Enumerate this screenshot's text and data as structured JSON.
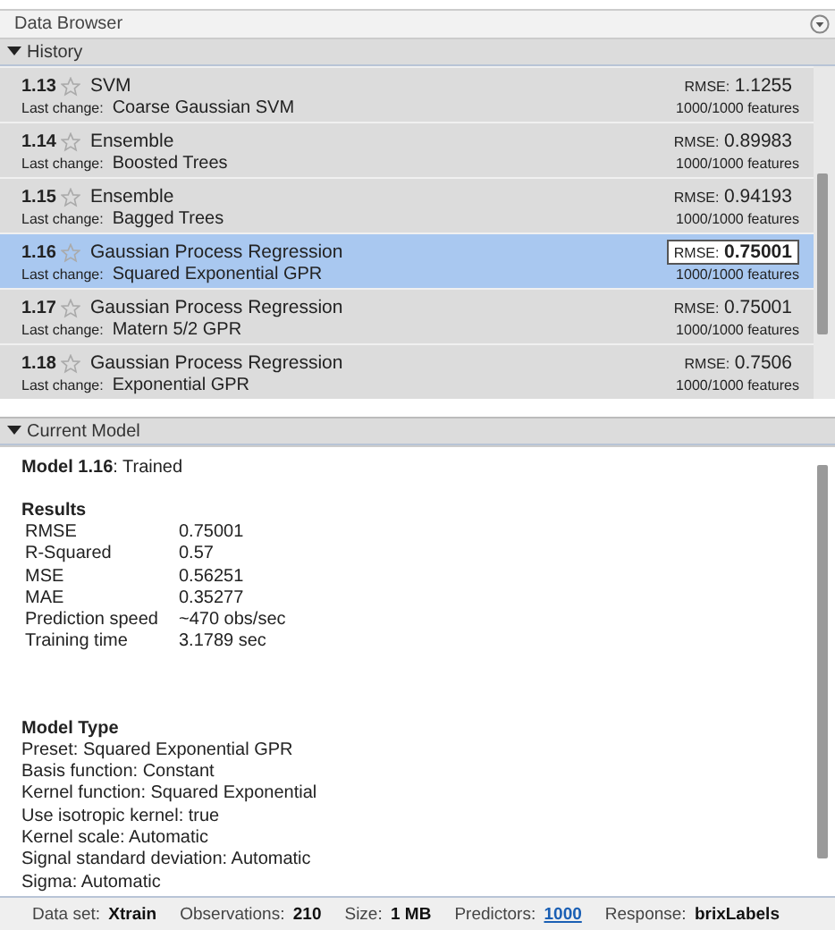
{
  "panel": {
    "title": "Data Browser"
  },
  "history": {
    "title": "History",
    "expanded": true,
    "rows": [
      {
        "id": "1.13",
        "type": "SVM",
        "change_label": "Last change:",
        "change": "Coarse Gaussian SVM",
        "metric_label": "RMSE:",
        "metric": "1.1255",
        "features": "1000/1000 features",
        "selected": false
      },
      {
        "id": "1.14",
        "type": "Ensemble",
        "change_label": "Last change:",
        "change": "Boosted Trees",
        "metric_label": "RMSE:",
        "metric": "0.89983",
        "features": "1000/1000 features",
        "selected": false
      },
      {
        "id": "1.15",
        "type": "Ensemble",
        "change_label": "Last change:",
        "change": "Bagged Trees",
        "metric_label": "RMSE:",
        "metric": "0.94193",
        "features": "1000/1000 features",
        "selected": false
      },
      {
        "id": "1.16",
        "type": "Gaussian Process Regression",
        "change_label": "Last change:",
        "change": "Squared Exponential GPR",
        "metric_label": "RMSE:",
        "metric": "0.75001",
        "features": "1000/1000 features",
        "selected": true
      },
      {
        "id": "1.17",
        "type": "Gaussian Process Regression",
        "change_label": "Last change:",
        "change": "Matern 5/2 GPR",
        "metric_label": "RMSE:",
        "metric": "0.75001",
        "features": "1000/1000 features",
        "selected": false
      },
      {
        "id": "1.18",
        "type": "Gaussian Process Regression",
        "change_label": "Last change:",
        "change": "Exponential GPR",
        "metric_label": "RMSE:",
        "metric": "0.7506",
        "features": "1000/1000 features",
        "selected": false
      }
    ]
  },
  "current_model": {
    "title": "Current Model",
    "expanded": true,
    "model_name": "Model 1.16",
    "status": ": Trained",
    "results_title": "Results",
    "results": [
      {
        "label": "RMSE",
        "value": "0.75001"
      },
      {
        "label": "R-Squared",
        "value": "0.57"
      },
      {
        "label": "MSE",
        "value": "0.56251"
      },
      {
        "label": "MAE",
        "value": "0.35277"
      },
      {
        "label": "Prediction speed",
        "value": "~470 obs/sec"
      },
      {
        "label": "Training time",
        "value": "3.1789 sec"
      }
    ],
    "type_title": "Model Type",
    "type_lines": [
      "Preset: Squared Exponential GPR",
      "Basis function: Constant",
      "Kernel function: Squared Exponential",
      "Use isotropic kernel: true",
      "Kernel scale: Automatic",
      "Signal standard deviation: Automatic",
      "Sigma: Automatic"
    ]
  },
  "status_bar": [
    {
      "label": "Data set:",
      "value": "Xtrain",
      "kind": "text"
    },
    {
      "label": "Observations:",
      "value": "210",
      "kind": "text"
    },
    {
      "label": "Size:",
      "value": "1 MB",
      "kind": "text"
    },
    {
      "label": "Predictors:",
      "value": "1000",
      "kind": "link"
    },
    {
      "label": "Response:",
      "value": "brixLabels",
      "kind": "text"
    }
  ]
}
